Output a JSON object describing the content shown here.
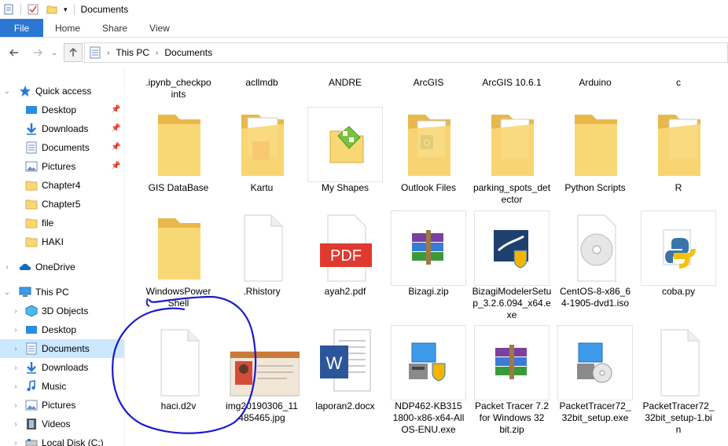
{
  "window": {
    "title": "Documents"
  },
  "ribbon": {
    "tabs": [
      {
        "label": "File",
        "active": true
      },
      {
        "label": "Home"
      },
      {
        "label": "Share"
      },
      {
        "label": "View"
      }
    ]
  },
  "address": {
    "crumbs": [
      "This PC",
      "Documents"
    ]
  },
  "sidebar": {
    "items": [
      {
        "label": "Quick access",
        "icon": "star-icon"
      },
      {
        "label": "Desktop",
        "icon": "desktop-folder-icon",
        "pinned": true
      },
      {
        "label": "Downloads",
        "icon": "downloads-arrow-icon",
        "pinned": true
      },
      {
        "label": "Documents",
        "icon": "documents-folder-icon",
        "pinned": true
      },
      {
        "label": "Pictures",
        "icon": "pictures-folder-icon",
        "pinned": true
      },
      {
        "label": "Chapter4",
        "icon": "folder-icon"
      },
      {
        "label": "Chapter5",
        "icon": "folder-icon"
      },
      {
        "label": "file",
        "icon": "folder-icon"
      },
      {
        "label": "HAKI",
        "icon": "folder-icon"
      },
      {
        "label": "OneDrive",
        "icon": "cloud-icon"
      },
      {
        "label": "This PC",
        "icon": "computer-icon"
      },
      {
        "label": "3D Objects",
        "icon": "3d-objects-icon"
      },
      {
        "label": "Desktop",
        "icon": "desktop-folder-icon"
      },
      {
        "label": "Documents",
        "icon": "documents-folder-icon",
        "selected": true
      },
      {
        "label": "Downloads",
        "icon": "downloads-arrow-icon"
      },
      {
        "label": "Music",
        "icon": "music-note-icon"
      },
      {
        "label": "Pictures",
        "icon": "pictures-folder-icon"
      },
      {
        "label": "Videos",
        "icon": "video-film-icon"
      },
      {
        "label": "Local Disk (C:)",
        "icon": "disk-drive-icon"
      }
    ]
  },
  "files": {
    "row0": [
      ".ipynb_checkpoints",
      "acllmdb",
      "ANDRE",
      "ArcGIS",
      "ArcGIS 10.6.1",
      "Arduino",
      "c"
    ],
    "row1": [
      "GIS DataBase",
      "Kartu",
      "My Shapes",
      "Outlook Files",
      "parking_spots_detector",
      "Python Scripts",
      "R"
    ],
    "row2": [
      "WindowsPowerShell",
      ".Rhistory",
      "ayah2.pdf",
      "Bizagi.zip",
      "BizagiModelerSetup_3.2.6.094_x64.exe",
      "CentOS-8-x86_64-1905-dvd1.iso",
      "coba.py"
    ],
    "row3": [
      "haci.d2v",
      "img20190306_11485465.jpg",
      "laporan2.docx",
      "NDP462-KB3151800-x86-x64-AllOS-ENU.exe",
      "Packet Tracer 7.2 for Windows 32 bit.zip",
      "PacketTracer72_32bit_setup.exe",
      "PacketTracer72_32bit_setup-1.bin"
    ]
  },
  "thumbs": {
    "pdf_text": "PDF",
    "word_letter": "W",
    "outlook_letter": "O"
  },
  "colors": {
    "accent": "#2b78d4",
    "folder": "#f8d775",
    "folder_dark": "#e8b94a",
    "selected": "#cce8ff",
    "annotation": "#1a1acc"
  }
}
